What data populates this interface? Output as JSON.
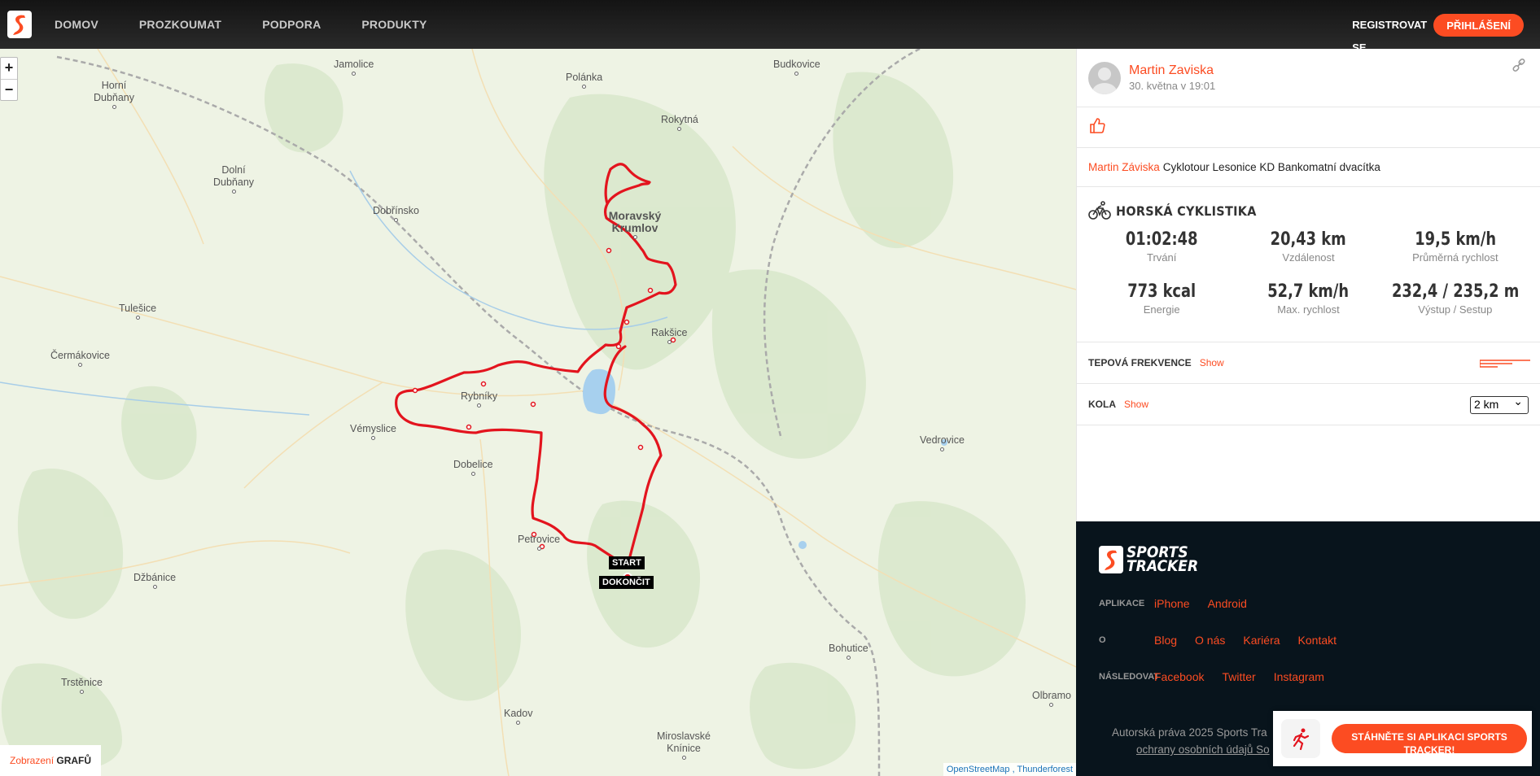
{
  "nav": {
    "items": [
      "DOMOV",
      "PROZKOUMAT",
      "PODPORA",
      "PRODUKTY"
    ],
    "register_label": "REGISTROVAT SE",
    "login_label": "PŘIHLÁŠENÍ"
  },
  "map": {
    "zoom_in": "+",
    "zoom_out": "−",
    "places": [
      "Jamolice",
      "Polánka",
      "Budkovice",
      "Horní Dubňany",
      "Rokytná",
      "Dolní Dubňany",
      "Dobřínsko",
      "Moravský Krumlov",
      "Tulešice",
      "Čermákovice",
      "Rakšice",
      "Rybníky",
      "Vémyslice",
      "Dobelice",
      "Vedrovice",
      "Petrovice",
      "Džbánice",
      "Bohutice",
      "Trstěnice",
      "Kadov",
      "Miroslavské Knínice",
      "Olbramo"
    ],
    "start_label": "START",
    "finish_label": "DOKONČIT",
    "graph_toggle_prefix": "Zobrazení",
    "graph_toggle_word": "GRAFŮ",
    "attribution_1": "OpenStreetMap",
    "attribution_sep": " , ",
    "attribution_2": "Thunderforest"
  },
  "workout": {
    "author": "Martin Zaviska",
    "date": "30. května v 19:01",
    "description_author": "Martin Záviska",
    "description": "Cyklotour Lesonice KD Bankomatní dvacítka",
    "activity_type": "HORSKÁ CYKLISTIKA",
    "stats": [
      {
        "value": "01:02:48",
        "label": "Trvání"
      },
      {
        "value": "20,43  km",
        "label": "Vzdálenost"
      },
      {
        "value": "19,5  km/h",
        "label": "Průměrná rychlost"
      },
      {
        "value": "773 kcal",
        "label": "Energie"
      },
      {
        "value": "52,7  km/h",
        "label": "Max. rychlost"
      },
      {
        "value": "232,4 / 235,2  m",
        "label": "Výstup / Sestup"
      }
    ],
    "hr_title": "TEPOVÁ FREKVENCE",
    "hr_show": "Show",
    "laps_title": "KOLA",
    "laps_show": "Show",
    "laps_select": "2 km"
  },
  "footer": {
    "brand_line1": "SPORTS",
    "brand_line2": "TRACKER",
    "apps_key": "APLIKACE",
    "apps": [
      "iPhone",
      "Android"
    ],
    "about_key": "O",
    "about": [
      "Blog",
      "O nás",
      "Kariéra",
      "Kontakt"
    ],
    "follow_key": "NÁSLEDOVAT",
    "follow": [
      "Facebook",
      "Twitter",
      "Instagram"
    ],
    "copyright": "Autorská práva 2025 Sports Tra",
    "privacy": "ochrany osobních údajů So",
    "app_banner": "STÁHNĚTE SI APLIKACI SPORTS TRACKER!"
  },
  "colors": {
    "accent": "#fc4c22",
    "route": "#e3141e",
    "footer_bg": "#08141c"
  }
}
